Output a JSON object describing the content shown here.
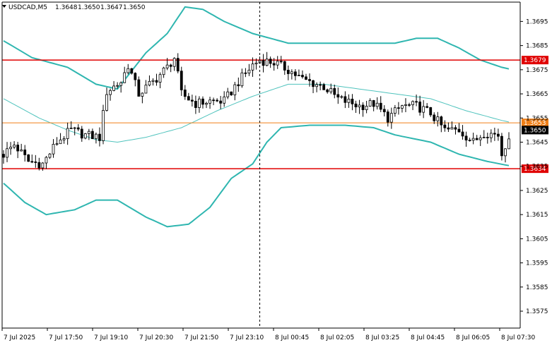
{
  "chart_data": {
    "type": "candlestick",
    "title": "USDCAD,M5",
    "ohlc_header": [
      "1.3648",
      "1.3650",
      "1.3647",
      "1.3650"
    ],
    "ylim": [
      1.3568,
      1.3703
    ],
    "y_ticks": [
      "1.3695",
      "1.3685",
      "1.3675",
      "1.3665",
      "1.3655",
      "1.3645",
      "1.3635",
      "1.3625",
      "1.3615",
      "1.3605",
      "1.3595",
      "1.3585",
      "1.3575"
    ],
    "x_ticks": [
      "7 Jul 2025",
      "7 Jul 17:50",
      "7 Jul 19:10",
      "7 Jul 20:30",
      "7 Jul 21:50",
      "7 Jul 23:10",
      "8 Jul 00:45",
      "8 Jul 02:05",
      "8 Jul 03:25",
      "8 Jul 04:45",
      "8 Jul 06:05",
      "8 Jul 07:30"
    ],
    "candle_count": 143,
    "upper_band": [
      [
        0,
        1.3687
      ],
      [
        8,
        1.368
      ],
      [
        18,
        1.3676
      ],
      [
        26,
        1.3669
      ],
      [
        32,
        1.3667
      ],
      [
        40,
        1.3682
      ],
      [
        46,
        1.369
      ],
      [
        51,
        1.3701
      ],
      [
        56,
        1.37
      ],
      [
        62,
        1.3695
      ],
      [
        70,
        1.369
      ],
      [
        75,
        1.3688
      ],
      [
        80,
        1.3686
      ],
      [
        90,
        1.3686
      ],
      [
        100,
        1.3686
      ],
      [
        110,
        1.3686
      ],
      [
        116,
        1.3688
      ],
      [
        122,
        1.3688
      ],
      [
        128,
        1.3684
      ],
      [
        134,
        1.3679
      ],
      [
        140,
        1.3676
      ],
      [
        143,
        1.3675
      ]
    ],
    "middle_band": [
      [
        0,
        1.3663
      ],
      [
        10,
        1.3655
      ],
      [
        18,
        1.365
      ],
      [
        26,
        1.3646
      ],
      [
        32,
        1.3645
      ],
      [
        40,
        1.3647
      ],
      [
        50,
        1.3651
      ],
      [
        60,
        1.3658
      ],
      [
        70,
        1.3664
      ],
      [
        80,
        1.3669
      ],
      [
        90,
        1.3669
      ],
      [
        100,
        1.3667
      ],
      [
        110,
        1.3665
      ],
      [
        120,
        1.3663
      ],
      [
        130,
        1.3658
      ],
      [
        140,
        1.3654
      ],
      [
        143,
        1.3653
      ]
    ],
    "lower_band": [
      [
        0,
        1.3628
      ],
      [
        6,
        1.362
      ],
      [
        12,
        1.3615
      ],
      [
        20,
        1.3617
      ],
      [
        26,
        1.3621
      ],
      [
        32,
        1.3621
      ],
      [
        40,
        1.3614
      ],
      [
        46,
        1.361
      ],
      [
        52,
        1.3611
      ],
      [
        58,
        1.3618
      ],
      [
        64,
        1.363
      ],
      [
        70,
        1.3636
      ],
      [
        74,
        1.3645
      ],
      [
        78,
        1.3651
      ],
      [
        86,
        1.3652
      ],
      [
        96,
        1.3652
      ],
      [
        104,
        1.3651
      ],
      [
        110,
        1.3648
      ],
      [
        120,
        1.3645
      ],
      [
        128,
        1.364
      ],
      [
        136,
        1.3637
      ],
      [
        143,
        1.3635
      ]
    ],
    "candles_path": [
      [
        0,
        1.364
      ],
      [
        3,
        1.3644
      ],
      [
        7,
        1.3637
      ],
      [
        11,
        1.3636
      ],
      [
        15,
        1.3645
      ],
      [
        19,
        1.365
      ],
      [
        23,
        1.3648
      ],
      [
        27,
        1.3647
      ],
      [
        29,
        1.3666
      ],
      [
        33,
        1.367
      ],
      [
        35,
        1.3677
      ],
      [
        38,
        1.3665
      ],
      [
        42,
        1.367
      ],
      [
        46,
        1.3676
      ],
      [
        48,
        1.368
      ],
      [
        50,
        1.3665
      ],
      [
        54,
        1.3661
      ],
      [
        58,
        1.3662
      ],
      [
        62,
        1.3662
      ],
      [
        66,
        1.367
      ],
      [
        70,
        1.3677
      ],
      [
        72,
        1.3679
      ],
      [
        76,
        1.3678
      ],
      [
        80,
        1.3675
      ],
      [
        84,
        1.3671
      ],
      [
        90,
        1.3668
      ],
      [
        94,
        1.3663
      ],
      [
        100,
        1.366
      ],
      [
        104,
        1.3661
      ],
      [
        108,
        1.3655
      ],
      [
        112,
        1.366
      ],
      [
        116,
        1.366
      ],
      [
        120,
        1.3657
      ],
      [
        124,
        1.365
      ],
      [
        128,
        1.365
      ],
      [
        132,
        1.3645
      ],
      [
        135,
        1.3649
      ],
      [
        139,
        1.3648
      ],
      [
        140,
        1.364
      ],
      [
        142,
        1.3648
      ],
      [
        143,
        1.365
      ]
    ],
    "vertical_separator_index": 72,
    "levels": [
      {
        "name": "resistance",
        "price": 1.3679,
        "label": "1.3679",
        "color": "#e00000"
      },
      {
        "name": "ask",
        "price": 1.3653,
        "label": "1.3653",
        "color": "#f07f17"
      },
      {
        "name": "bid",
        "price": 1.365,
        "label": "1.3650",
        "color": "#000000"
      },
      {
        "name": "support",
        "price": 1.3634,
        "label": "1.3634",
        "color": "#e00000"
      }
    ],
    "colors": {
      "band": "#2fb6b0",
      "band_middle": "#4fc3bd",
      "candle_up": "#ffffff",
      "candle_down": "#000000",
      "grid": "#000000"
    }
  }
}
